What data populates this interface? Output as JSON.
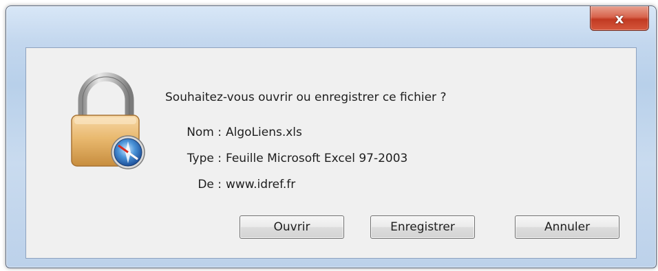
{
  "window": {
    "close_label": "x"
  },
  "dialog": {
    "question": "Souhaitez-vous ouvrir ou enregistrer ce fichier ?",
    "fields": [
      {
        "label": "Nom :",
        "value": "AlgoLiens.xls"
      },
      {
        "label": "Type :",
        "value": "Feuille Microsoft Excel 97-2003"
      },
      {
        "label": "De :",
        "value": "www.idref.fr"
      }
    ],
    "icon": "lock-icon"
  },
  "buttons": {
    "open_label": "Ouvrir",
    "save_label": "Enregistrer",
    "cancel_label": "Annuler"
  },
  "colors": {
    "close_button": "#c8452c",
    "frame": "#c3d7ee",
    "client_bg": "#f0f0f0"
  }
}
